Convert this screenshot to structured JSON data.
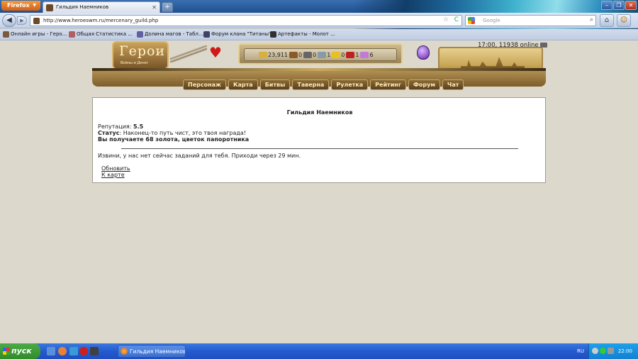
{
  "browser": {
    "menu_button": "Firefox",
    "tab_title": "Гильдия Наемников",
    "url": "http://www.heroeswm.ru/mercenary_guild.php",
    "search_placeholder": "Google",
    "bookmarks": [
      {
        "label": "Онлайн игры - Геро..."
      },
      {
        "label": "Общая Статистика ..."
      },
      {
        "label": "Долина магов - Табл..."
      },
      {
        "label": "Форум клана \"Титаны\""
      },
      {
        "label": "Артефакты - Молот ..."
      }
    ]
  },
  "game": {
    "logo_text": "Герои",
    "logo_subtitle": "Войны и Денег",
    "time_online": "17:00, 11938 online",
    "resources": [
      {
        "icon": "gold-icon",
        "value": "23,911",
        "color": "#d8b040"
      },
      {
        "icon": "wood-icon",
        "value": "0",
        "color": "#8a5a2a"
      },
      {
        "icon": "ore-icon",
        "value": "0",
        "color": "#666666"
      },
      {
        "icon": "mercury-icon",
        "value": "1",
        "color": "#8899aa"
      },
      {
        "icon": "sulfur-icon",
        "value": "0",
        "color": "#e8c020"
      },
      {
        "icon": "crystal-icon",
        "value": "1",
        "color": "#c02020"
      },
      {
        "icon": "gems-icon",
        "value": "6",
        "color": "#c07ad8"
      }
    ],
    "nav": [
      "Персонаж",
      "Карта",
      "Битвы",
      "Таверна",
      "Рулетка",
      "Рейтинг",
      "Форум",
      "Чат"
    ]
  },
  "panel": {
    "title": "Гильдия Наемников",
    "reputation_label": "Репутация: ",
    "reputation_value": "5.5",
    "status_label": "Статус",
    "status_text": ": Наконец-то путь чист, это твоя награда!",
    "reward_text": "Вы получаете 68 золота, цветок папоротника",
    "no_tasks_text": "Извини, у нас нет сейчас заданий для тебя. Приходи через 29 мин.",
    "refresh_link": "Обновить",
    "map_link": "К карте"
  },
  "taskbar": {
    "start_label": "пуск",
    "task_label": "Гильдия Наемников ...",
    "language": "RU",
    "clock": "22:00"
  }
}
